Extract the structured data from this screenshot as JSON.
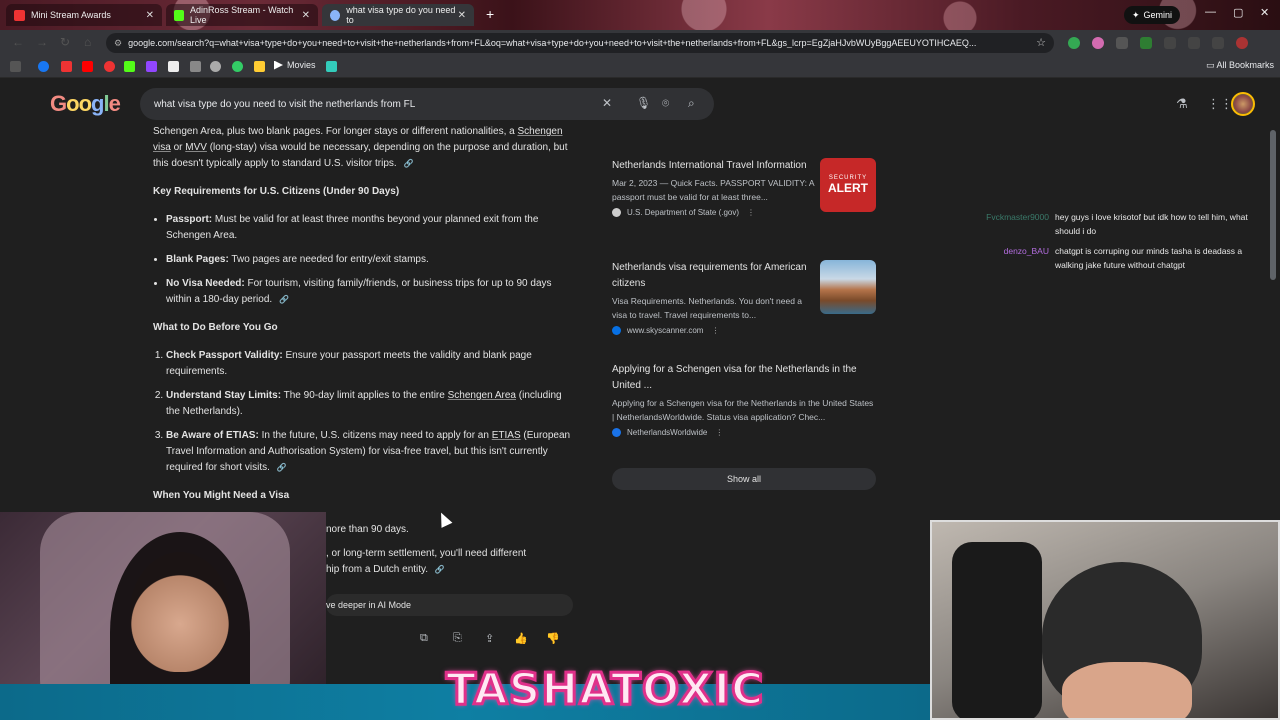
{
  "browser": {
    "tabs": [
      {
        "title": "Mini Stream Awards",
        "color": "#e8eaed"
      },
      {
        "title": "AdinRoss Stream - Watch Live",
        "color": "#53fc18"
      },
      {
        "title": "what visa type do you need to",
        "color": "#8ab4f8"
      }
    ],
    "new_tab": "+",
    "gemini_label": "Gemini",
    "url": "google.com/search?q=what+visa+type+do+you+need+to+visit+the+netherlands+from+FL&oq=what+visa+type+do+you+need+to+visit+the+netherlands+from+FL&gs_lcrp=EgZjaHJvbWUyBggAEEUYOTIHCAEQ...",
    "bookmarks_movies": "Movies",
    "all_bookmarks": "All Bookmarks"
  },
  "search": {
    "logo": [
      "G",
      "o",
      "o",
      "g",
      "l",
      "e"
    ],
    "query": "what visa type do you need to visit the netherlands from FL"
  },
  "ai": {
    "intro": "Schengen Area, plus two blank pages. For longer stays or different nationalities, a",
    "intro_link1": "Schengen visa",
    "intro_or": " or ",
    "intro_link2": "MVV",
    "intro_rest": " (long-stay) visa would be necessary, depending on the purpose and duration, but this doesn't typically apply to standard U.S. visitor trips.",
    "h1": "Key Requirements for U.S. Citizens (Under 90 Days)",
    "req": [
      {
        "label": "Passport:",
        "text": " Must be valid for at least three months beyond your planned exit from the Schengen Area."
      },
      {
        "label": "Blank Pages:",
        "text": " Two pages are needed for entry/exit stamps."
      },
      {
        "label": "No Visa Needed:",
        "text": " For tourism, visiting family/friends, or business trips for up to 90 days within a 180-day period."
      }
    ],
    "h2": "What to Do Before You Go",
    "todo1_label": "Check Passport Validity:",
    "todo1_text": " Ensure your passport meets the validity and blank page requirements.",
    "todo2_label": "Understand Stay Limits:",
    "todo2_text": " The 90-day limit applies to the entire ",
    "todo2_link": "Schengen Area",
    "todo2_tail": " (including the Netherlands).",
    "todo3_label": "Be Aware of ETIAS:",
    "todo3_text": " In the future, U.S. citizens may need to apply for an ",
    "todo3_link": "ETIAS",
    "todo3_tail": " (European Travel Information and Authorisation System) for visa-free travel, but this isn't currently required for short visits.",
    "h3": "When You Might Need a Visa",
    "partial1": "nore than 90 days.",
    "partial2": ", or long-term settlement, you'll need different",
    "partial3": "hip from a Dutch entity.",
    "deeper": "ve deeper in AI Mode"
  },
  "results": [
    {
      "title": "Netherlands International Travel Information",
      "snippet": "Mar 2, 2023 — Quick Facts. PASSPORT VALIDITY: A passport must be valid for at least three...",
      "source": "U.S. Department of State (.gov)",
      "thumb_small": "SECURITY",
      "thumb_big": "ALERT"
    },
    {
      "title": "Netherlands visa requirements for American citizens",
      "snippet": "Visa Requirements. Netherlands. You don't need a visa to travel. Travel requirements to...",
      "source": "www.skyscanner.com"
    },
    {
      "title": "Applying for a Schengen visa for the Netherlands in the United ...",
      "snippet": "Applying for a Schengen visa for the Netherlands in the United States | NetherlandsWorldwide. Status visa application? Chec...",
      "source": "NetherlandsWorldwide"
    }
  ],
  "show_all": "Show all",
  "chat": [
    {
      "user": "Fvckmaster9000",
      "msg": "hey guys i love krisotof but idk how to tell him, what should i do",
      "color": "#3a7a6a"
    },
    {
      "user": "denzo_BAU",
      "msg": "chatgpt is corruping our minds tasha is deadass a walking jake future without chatgpt",
      "color": "#b46ee0"
    }
  ],
  "overlay_banner": "TASHATOXIC"
}
